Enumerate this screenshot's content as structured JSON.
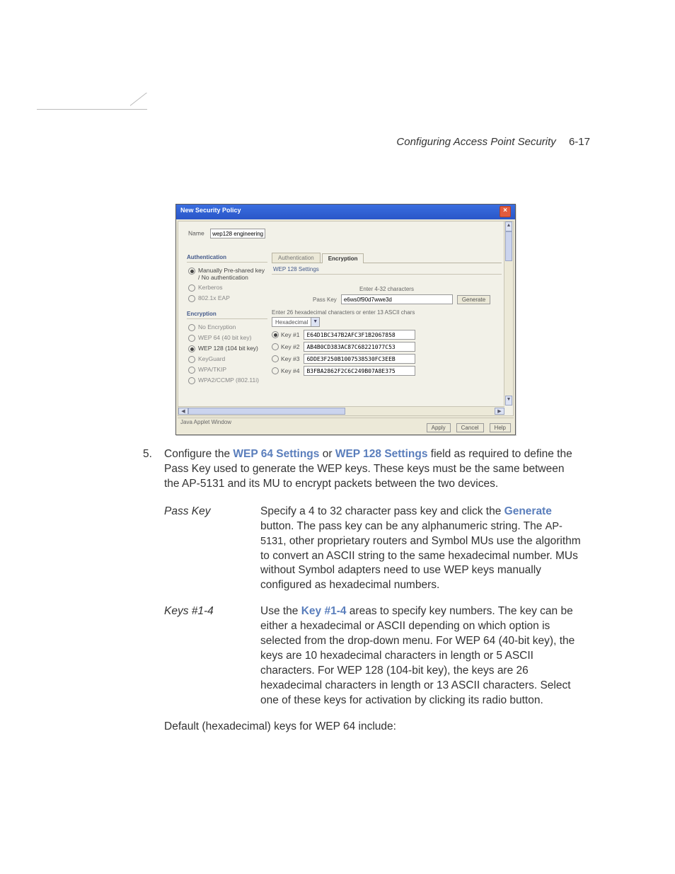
{
  "header": {
    "running_title": "Configuring Access Point Security",
    "page_number": "6-17"
  },
  "window": {
    "title": "New Security Policy",
    "name_label": "Name",
    "name_value": "wep128 engineering",
    "statusbar": "Java Applet Window",
    "left": {
      "auth_title": "Authentication",
      "auth_options": [
        {
          "label": "Manually Pre-shared key / No authentication",
          "selected": true
        },
        {
          "label": "Kerberos",
          "selected": false
        },
        {
          "label": "802.1x EAP",
          "selected": false
        }
      ],
      "enc_title": "Encryption",
      "enc_options": [
        {
          "label": "No Encryption",
          "selected": false
        },
        {
          "label": "WEP 64 (40 bit key)",
          "selected": false
        },
        {
          "label": "WEP 128 (104 bit key)",
          "selected": true
        },
        {
          "label": "KeyGuard",
          "selected": false
        },
        {
          "label": "WPA/TKIP",
          "selected": false
        },
        {
          "label": "WPA2/CCMP (802.11i)",
          "selected": false
        }
      ]
    },
    "right": {
      "tab_auth": "Authentication",
      "tab_enc": "Encryption",
      "panel_title": "WEP 128 Settings",
      "instr1": "Enter 4-32 characters",
      "passkey_label": "Pass Key",
      "passkey_value": "e6ws0f90d7wwe3d",
      "generate_btn": "Generate",
      "instr2": "Enter 26 hexadecimal characters or enter 13 ASCII chars",
      "format_dd": "Hexadecimal",
      "keys": [
        {
          "label": "Key #1",
          "value": "E64D1BC347B2AFC3F1B2067858",
          "selected": true
        },
        {
          "label": "Key #2",
          "value": "AB4B0CD383AC87C68221077C53",
          "selected": false
        },
        {
          "label": "Key #3",
          "value": "6DDE3F250B1007538530FC3EEB",
          "selected": false
        },
        {
          "label": "Key #4",
          "value": "B3FBA2862F2C6C249B07A8E375",
          "selected": false
        }
      ]
    },
    "buttons": {
      "apply": "Apply",
      "cancel": "Cancel",
      "help": "Help"
    }
  },
  "doc": {
    "step_num": "5.",
    "step_text_1": "Configure the ",
    "step_link_1": "WEP 64 Settings",
    "step_text_2": " or ",
    "step_link_2": "WEP 128 Settings",
    "step_text_3": " field as required to define the Pass Key used to generate the WEP keys. These keys must be the same between the AP-5131 and its MU to encrypt packets between the two devices.",
    "passkey_term": "Pass Key",
    "passkey_desc_1": "Specify a 4 to 32 character pass key and click the ",
    "passkey_desc_link": "Generate",
    "passkey_desc_2": " button. The pass key can be any alphanumeric string. The ",
    "passkey_model": "AP-5131",
    "passkey_desc_3": ", other proprietary routers and Symbol MUs use the algorithm to convert an ASCII string to the same hexadecimal number. MUs without Symbol adapters need to use WEP keys manually configured as hexadecimal numbers.",
    "keys_term": "Keys #1-4",
    "keys_desc_1": "Use the ",
    "keys_desc_link": "Key #1-4",
    "keys_desc_2": " areas to specify key numbers. The key can be either a hexadecimal or ASCII depending on which option is selected from the drop-down menu. For WEP 64 (40-bit key), the keys are 10 hexadecimal characters in length or 5 ASCII characters. For WEP 128 (104-bit key), the keys are 26 hexadecimal characters in length or 13 ASCII characters. Select one of these keys for activation by clicking its radio button.",
    "closing": "Default (hexadecimal) keys for WEP 64 include:"
  }
}
